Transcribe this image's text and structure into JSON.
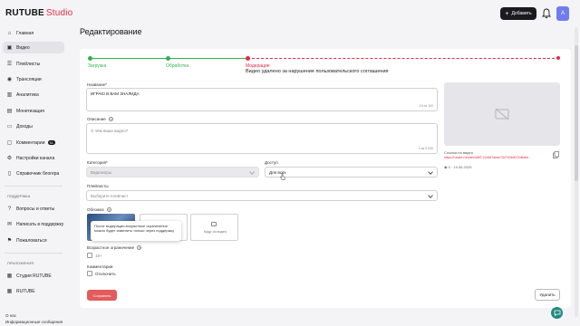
{
  "brand": {
    "name": "RUTUBE",
    "suffix": "Studio",
    "accent": "#e6294b"
  },
  "header": {
    "add_label": "Добавить",
    "avatar_letter": "А"
  },
  "sidebar": {
    "items": [
      {
        "label": "Главная",
        "icon": "home-icon"
      },
      {
        "label": "Видео",
        "icon": "video-icon"
      },
      {
        "label": "Плейлисты",
        "icon": "playlist-icon"
      },
      {
        "label": "Трансляции",
        "icon": "broadcast-icon"
      },
      {
        "label": "Аналитика",
        "icon": "analytics-icon"
      },
      {
        "label": "Монетизация",
        "icon": "monetization-icon"
      },
      {
        "label": "Доходы",
        "icon": "wallet-icon"
      },
      {
        "label": "Комментарии",
        "icon": "comment-icon",
        "badge": "51"
      },
      {
        "label": "Настройки канала",
        "icon": "settings-icon"
      },
      {
        "label": "Справочник блогера",
        "icon": "book-icon"
      }
    ],
    "support_head": "ПОДДЕРЖКА",
    "support": [
      {
        "label": "Вопросы и ответы",
        "icon": "question-icon"
      },
      {
        "label": "Написать в поддержку",
        "icon": "mail-icon"
      },
      {
        "label": "Пожаловаться",
        "icon": "flag-icon"
      }
    ],
    "apps_head": "ПРИЛОЖЕНИЯ",
    "apps": [
      {
        "label": "Студия RUTUBE",
        "icon": "studio-app-icon"
      },
      {
        "label": "RUTUBE",
        "icon": "rutube-app-icon"
      }
    ],
    "footer": [
      "О нас",
      "Информационные сообщения"
    ]
  },
  "page": {
    "title": "Редактирование"
  },
  "steps": [
    {
      "label": "Загрузка",
      "color": "#2fb34a"
    },
    {
      "label": "Обработка",
      "color": "#2fb34a"
    },
    {
      "label": "Модерация",
      "color": "#e6294b",
      "note": "Видео удалено за нарушение пользовательского соглашения"
    }
  ],
  "form": {
    "name_label": "Название*",
    "name_value": "ИГРАЮ В ВАМ ЗНАЛИДА",
    "name_count": "19 из 100",
    "desc_label": "Описание",
    "desc_placeholder": "О чём ваше видео?",
    "desc_count": "0 из 5 000",
    "category_label": "Категория*",
    "category_value": "Видеоигры",
    "access_label": "Доступ",
    "access_value": "Для всех",
    "playlists_label": "Плейлисты",
    "playlists_placeholder": "Выберите плейлист",
    "cover_label": "Обложка",
    "cover_add": "Кадр из видео",
    "tooltip": "После модерации возрастные ограничения можно будет изменить только через поддержку",
    "age_label": "Возрастное ограничение",
    "age_option": "18+",
    "comments_label": "Комментарии",
    "comments_option": "Отключить",
    "save_label": "Сохранить",
    "delete_label": "Удалить"
  },
  "video": {
    "link_label": "Ссылка на видео",
    "link_url": "https://rutube.ru/video/b8f7-22c657aede732763bd072d6dbe...",
    "stats": "0 · 19.06.2025"
  }
}
